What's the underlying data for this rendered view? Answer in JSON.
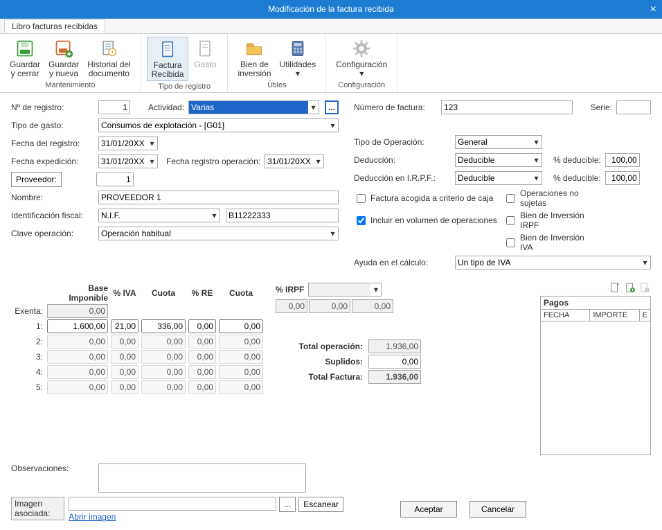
{
  "window": {
    "title": "Modificación de la factura recibida"
  },
  "tabs": {
    "main": "Libro facturas recibidas"
  },
  "ribbon": {
    "groups": {
      "mantenimiento": {
        "name": "Mantenimiento",
        "save_close": "Guardar\ny cerrar",
        "save_new": "Guardar\ny nueva",
        "history": "Historial del\ndocumento"
      },
      "tipo_registro": {
        "name": "Tipo de registro",
        "factura": "Factura\nRecibida",
        "gasto": "Gasto"
      },
      "utiles": {
        "name": "Útiles",
        "bien_inversion": "Bien de\ninversión",
        "utilidades": "Utilidades"
      },
      "configuracion": {
        "name": "Configuración",
        "config": "Configuración"
      }
    }
  },
  "labels": {
    "num_registro": "Nº de registro:",
    "actividad": "Actividad:",
    "tipo_gasto": "Tipo de gasto:",
    "fecha_registro": "Fecha del registro:",
    "fecha_expedicion": "Fecha expedición:",
    "fecha_reg_op": "Fecha registro operación:",
    "proveedor_btn": "Proveedor:",
    "nombre": "Nombre:",
    "id_fiscal": "Identificación fiscal:",
    "clave_op": "Clave operación:",
    "num_factura": "Número de factura:",
    "serie": "Serie:",
    "tipo_operacion": "Tipo de Operación:",
    "deduccion": "Deducción:",
    "ded_irpf": "Deducción en I.R.P.F.:",
    "pct_deducible": "% deducible:",
    "cb_caja": "Factura acogida a criterio de caja",
    "cb_no_sujetas": "Operaciones no sujetas",
    "cb_volumen": "Incluir en  volumen de operaciones",
    "cb_bien_irpf": "Bien de Inversión IRPF",
    "cb_bien_iva": "Bien de Inversión IVA",
    "ayuda": "Ayuda en el cálculo:",
    "observaciones": "Observaciones:",
    "imagen_asociada": "Imagen asociada:",
    "escanear": "Escanear",
    "abrir_imagen": "Abrir imagen",
    "aceptar": "Aceptar",
    "cancelar": "Cancelar",
    "pagos": "Pagos",
    "fecha_col": "FECHA",
    "importe_col": "IMPORTE",
    "e_col": "E",
    "dots": "..."
  },
  "values": {
    "num_registro": "1",
    "actividad": "Varias",
    "tipo_gasto": "Consumos de explotación - [G01]",
    "fecha_registro": "31/01/20XX",
    "fecha_expedicion": "31/01/20XX",
    "fecha_reg_op": "31/01/20XX",
    "proveedor": "1",
    "nombre": "PROVEEDOR 1",
    "id_fiscal_tipo": "N.I.F.",
    "id_fiscal_num": "B11222333",
    "clave_op": "Operación habitual",
    "num_factura": "123",
    "serie": "",
    "tipo_operacion": "General",
    "deduccion": "Deducible",
    "ded_irpf": "Deducible",
    "pct_deducible1": "100,00",
    "pct_deducible2": "100,00",
    "ayuda": "Un tipo de IVA",
    "observaciones": "",
    "imagen": ""
  },
  "checks": {
    "caja": false,
    "no_sujetas": false,
    "volumen": true,
    "bien_irpf": false,
    "bien_iva": false
  },
  "iva": {
    "headers": {
      "base": "Base Imponible",
      "piva": "% IVA",
      "cuota": "Cuota",
      "pre": "% RE",
      "cuota2": "Cuota",
      "pirpf": "% IRPF"
    },
    "labels": {
      "exenta": "Exenta:",
      "r1": "1:",
      "r2": "2:",
      "r3": "3:",
      "r4": "4:",
      "r5": "5:"
    },
    "rows": {
      "ex": {
        "base": "0,00"
      },
      "r1": {
        "base": "1.600,00",
        "piva": "21,00",
        "cuota": "336,00",
        "pre": "0,00",
        "cuota2": "0,00"
      },
      "r2": {
        "base": "0,00",
        "piva": "0,00",
        "cuota": "0,00",
        "pre": "0,00",
        "cuota2": "0,00"
      },
      "r3": {
        "base": "0,00",
        "piva": "0,00",
        "cuota": "0,00",
        "pre": "0,00",
        "cuota2": "0,00"
      },
      "r4": {
        "base": "0,00",
        "piva": "0,00",
        "cuota": "0,00",
        "pre": "0,00",
        "cuota2": "0,00"
      },
      "r5": {
        "base": "0,00",
        "piva": "0,00",
        "cuota": "0,00",
        "pre": "0,00",
        "cuota2": "0,00"
      }
    },
    "irpf": {
      "rate": "0,00",
      "base": "0,00",
      "cuota": "0,00"
    },
    "totals": {
      "total_op_l": "Total operación:",
      "total_op": "1.936,00",
      "suplidos_l": "Suplidos:",
      "suplidos": "0,00",
      "total_fact_l": "Total Factura:",
      "total_fact": "1.936,00"
    }
  }
}
